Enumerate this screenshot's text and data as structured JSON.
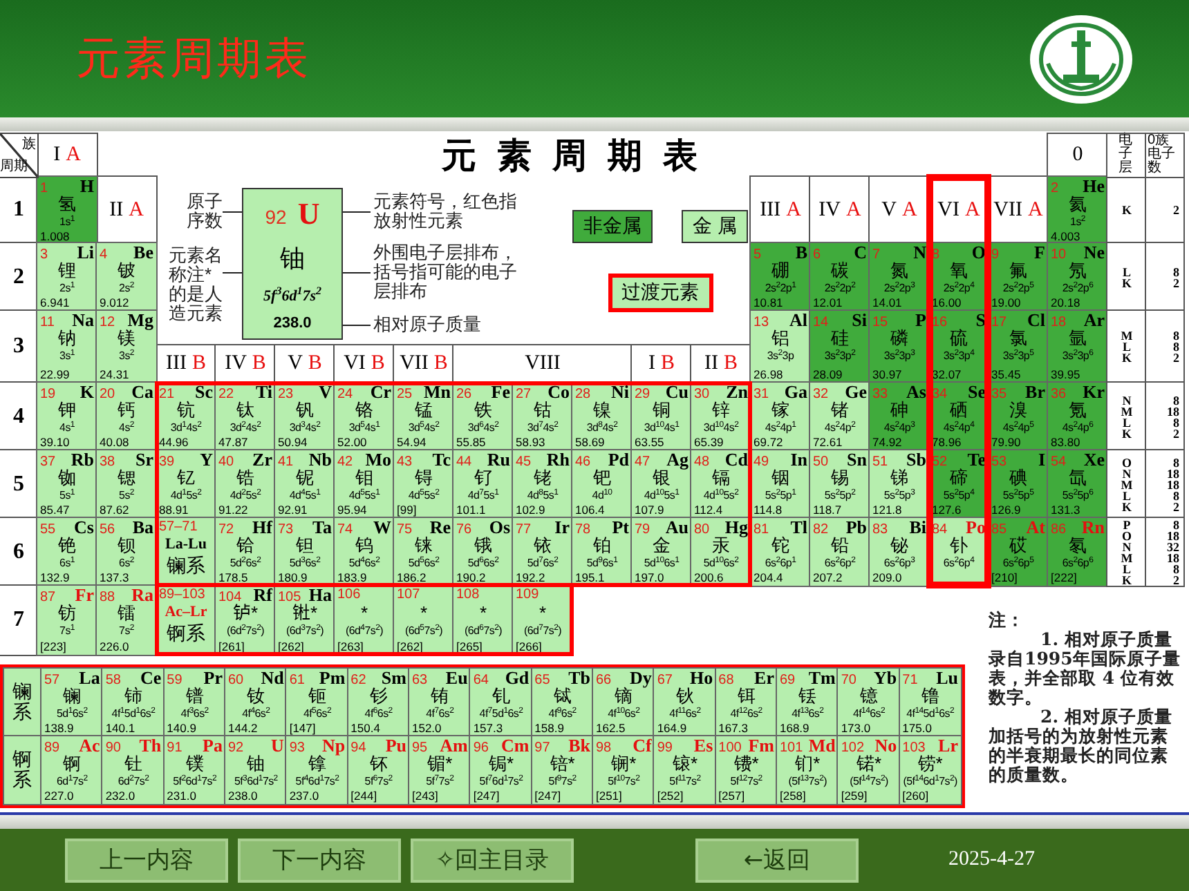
{
  "header": {
    "title": "元素周期表"
  },
  "table": {
    "corner": {
      "top": "族",
      "bottom": "周期"
    },
    "title": "元 素 周 期 表",
    "groups": [
      {
        "roman": "I",
        "letter": "A",
        "highlighted": false
      },
      {
        "roman": "II",
        "letter": "A",
        "highlighted": false
      },
      {
        "roman": "III",
        "letter": "B",
        "highlighted": false
      },
      {
        "roman": "IV",
        "letter": "B",
        "highlighted": false
      },
      {
        "roman": "V",
        "letter": "B",
        "highlighted": false
      },
      {
        "roman": "VI",
        "letter": "B",
        "highlighted": false
      },
      {
        "roman": "VII",
        "letter": "B",
        "highlighted": false
      },
      {
        "roman": "VIII",
        "highlighted": false
      },
      {
        "roman": "I",
        "letter": "B",
        "highlighted": false
      },
      {
        "roman": "II",
        "letter": "B",
        "highlighted": false
      },
      {
        "roman": "III",
        "letter": "A",
        "highlighted": false
      },
      {
        "roman": "IV",
        "letter": "A",
        "highlighted": false
      },
      {
        "roman": "V",
        "letter": "A",
        "highlighted": false
      },
      {
        "roman": "VI",
        "letter": "A",
        "highlighted": true
      },
      {
        "roman": "VII",
        "letter": "A",
        "highlighted": false
      },
      {
        "roman": "0",
        "highlighted": false
      }
    ],
    "shell_headers": [
      "电子层",
      "0族电子数"
    ],
    "periods": [
      {
        "number": "1",
        "shells": [
          "K"
        ],
        "counts": [
          "2"
        ],
        "cells": [
          {
            "n": "1",
            "symbol": "H",
            "name": "氢",
            "config": "1s$^{1}$",
            "mass": "1.008",
            "kind": "nonmetal",
            "radioactive": false
          },
          {
            "n": "2",
            "symbol": "He",
            "name": "氦",
            "config": "1s$^{2}$",
            "mass": "4.003",
            "kind": "nonmetal",
            "radioactive": false
          }
        ]
      },
      {
        "number": "2",
        "shells": [
          "L",
          "K"
        ],
        "counts": [
          "8",
          "2"
        ],
        "cells": [
          {
            "n": "3",
            "symbol": "Li",
            "name": "锂",
            "config": "2s$^{1}$",
            "mass": "6.941",
            "kind": "metal",
            "radioactive": false
          },
          {
            "n": "4",
            "symbol": "Be",
            "name": "铍",
            "config": "2s$^{2}$",
            "mass": "9.012",
            "kind": "metal",
            "radioactive": false
          },
          {
            "n": "5",
            "symbol": "B",
            "name": "硼",
            "config": "2s$^{2}$2p$^{1}$",
            "mass": "10.81",
            "kind": "nonmetal",
            "radioactive": false
          },
          {
            "n": "6",
            "symbol": "C",
            "name": "碳",
            "config": "2s$^{2}$2p$^{2}$",
            "mass": "12.01",
            "kind": "nonmetal",
            "radioactive": false
          },
          {
            "n": "7",
            "symbol": "N",
            "name": "氮",
            "config": "2s$^{2}$2p$^{3}$",
            "mass": "14.01",
            "kind": "nonmetal",
            "radioactive": false
          },
          {
            "n": "8",
            "symbol": "O",
            "name": "氧",
            "config": "2s$^{2}$2p$^{4}$",
            "mass": "16.00",
            "kind": "nonmetal",
            "radioactive": false
          },
          {
            "n": "9",
            "symbol": "F",
            "name": "氟",
            "config": "2s$^{2}$2p$^{5}$",
            "mass": "19.00",
            "kind": "nonmetal",
            "radioactive": false
          },
          {
            "n": "10",
            "symbol": "Ne",
            "name": "氖",
            "config": "2s$^{2}$2p$^{6}$",
            "mass": "20.18",
            "kind": "nonmetal",
            "radioactive": false
          }
        ]
      },
      {
        "number": "3",
        "shells": [
          "M",
          "L",
          "K"
        ],
        "counts": [
          "8",
          "8",
          "2"
        ],
        "cells": [
          {
            "n": "11",
            "symbol": "Na",
            "name": "钠",
            "config": "3s$^{1}$",
            "mass": "22.99",
            "kind": "metal",
            "radioactive": false
          },
          {
            "n": "12",
            "symbol": "Mg",
            "name": "镁",
            "config": "3s$^{2}$",
            "mass": "24.31",
            "kind": "metal",
            "radioactive": false
          },
          {
            "n": "13",
            "symbol": "Al",
            "name": "铝",
            "config": "3s$^{2}$3p",
            "mass": "26.98",
            "kind": "metal",
            "radioactive": false
          },
          {
            "n": "14",
            "symbol": "Si",
            "name": "硅",
            "config": "3s$^{2}$3p$^{2}$",
            "mass": "28.09",
            "kind": "nonmetal",
            "radioactive": false
          },
          {
            "n": "15",
            "symbol": "P",
            "name": "磷",
            "config": "3s$^{2}$3p$^{3}$",
            "mass": "30.97",
            "kind": "nonmetal",
            "radioactive": false
          },
          {
            "n": "16",
            "symbol": "S",
            "name": "硫",
            "config": "3s$^{2}$3p$^{4}$",
            "mass": "32.07",
            "kind": "nonmetal",
            "radioactive": false
          },
          {
            "n": "17",
            "symbol": "Cl",
            "name": "氯",
            "config": "3s$^{2}$3p$^{5}$",
            "mass": "35.45",
            "kind": "nonmetal",
            "radioactive": false
          },
          {
            "n": "18",
            "symbol": "Ar",
            "name": "氩",
            "config": "3s$^{2}$3p$^{6}$",
            "mass": "39.95",
            "kind": "nonmetal",
            "radioactive": false
          }
        ]
      },
      {
        "number": "4",
        "shells": [
          "N",
          "M",
          "L",
          "K"
        ],
        "counts": [
          "8",
          "18",
          "8",
          "2"
        ],
        "cells": [
          {
            "n": "19",
            "symbol": "K",
            "name": "钾",
            "config": "4s$^{1}$",
            "mass": "39.10",
            "kind": "metal",
            "radioactive": false
          },
          {
            "n": "20",
            "symbol": "Ca",
            "name": "钙",
            "config": "4s$^{2}$",
            "mass": "40.08",
            "kind": "metal",
            "radioactive": false
          },
          {
            "n": "21",
            "symbol": "Sc",
            "name": "钪",
            "config": "3d$^{1}$4s$^{2}$",
            "mass": "44.96",
            "kind": "metal",
            "radioactive": false
          },
          {
            "n": "22",
            "symbol": "Ti",
            "name": "钛",
            "config": "3d$^{2}$4s$^{2}$",
            "mass": "47.87",
            "kind": "metal",
            "radioactive": false
          },
          {
            "n": "23",
            "symbol": "V",
            "name": "钒",
            "config": "3d$^{3}$4s$^{2}$",
            "mass": "50.94",
            "kind": "metal",
            "radioactive": false
          },
          {
            "n": "24",
            "symbol": "Cr",
            "name": "铬",
            "config": "3d$^{5}$4s$^{1}$",
            "mass": "52.00",
            "kind": "metal",
            "radioactive": false
          },
          {
            "n": "25",
            "symbol": "Mn",
            "name": "锰",
            "config": "3d$^{5}$4s$^{2}$",
            "mass": "54.94",
            "kind": "metal",
            "radioactive": false
          },
          {
            "n": "26",
            "symbol": "Fe",
            "name": "铁",
            "config": "3d$^{6}$4s$^{2}$",
            "mass": "55.85",
            "kind": "metal",
            "radioactive": false
          },
          {
            "n": "27",
            "symbol": "Co",
            "name": "钴",
            "config": "3d$^{7}$4s$^{2}$",
            "mass": "58.93",
            "kind": "metal",
            "radioactive": false
          },
          {
            "n": "28",
            "symbol": "Ni",
            "name": "镍",
            "config": "3d$^{8}$4s$^{2}$",
            "mass": "58.69",
            "kind": "metal",
            "radioactive": false
          },
          {
            "n": "29",
            "symbol": "Cu",
            "name": "铜",
            "config": "3d$^{10}$4s$^{1}$",
            "mass": "63.55",
            "kind": "metal",
            "radioactive": false
          },
          {
            "n": "30",
            "symbol": "Zn",
            "name": "锌",
            "config": "3d$^{10}$4s$^{2}$",
            "mass": "65.39",
            "kind": "metal",
            "radioactive": false
          },
          {
            "n": "31",
            "symbol": "Ga",
            "name": "镓",
            "config": "4s$^{2}$4p$^{1}$",
            "mass": "69.72",
            "kind": "metal",
            "radioactive": false
          },
          {
            "n": "32",
            "symbol": "Ge",
            "name": "锗",
            "config": "4s$^{2}$4p$^{2}$",
            "mass": "72.61",
            "kind": "metal",
            "radioactive": false
          },
          {
            "n": "33",
            "symbol": "As",
            "name": "砷",
            "config": "4s$^{2}$4p$^{3}$",
            "mass": "74.92",
            "kind": "nonmetal",
            "radioactive": false
          },
          {
            "n": "34",
            "symbol": "Se",
            "name": "硒",
            "config": "4s$^{2}$4p$^{4}$",
            "mass": "78.96",
            "kind": "nonmetal",
            "radioactive": false
          },
          {
            "n": "35",
            "symbol": "Br",
            "name": "溴",
            "config": "4s$^{2}$4p$^{5}$",
            "mass": "79.90",
            "kind": "nonmetal",
            "radioactive": false
          },
          {
            "n": "36",
            "symbol": "Kr",
            "name": "氪",
            "config": "4s$^{2}$4p$^{6}$",
            "mass": "83.80",
            "kind": "nonmetal",
            "radioactive": false
          }
        ]
      },
      {
        "number": "5",
        "shells": [
          "O",
          "N",
          "M",
          "L",
          "K"
        ],
        "counts": [
          "8",
          "18",
          "18",
          "8",
          "2"
        ],
        "cells": [
          {
            "n": "37",
            "symbol": "Rb",
            "name": "铷",
            "config": "5s$^{1}$",
            "mass": "85.47",
            "kind": "metal",
            "radioactive": false
          },
          {
            "n": "38",
            "symbol": "Sr",
            "name": "锶",
            "config": "5s$^{2}$",
            "mass": "87.62",
            "kind": "metal",
            "radioactive": false
          },
          {
            "n": "39",
            "symbol": "Y",
            "name": "钇",
            "config": "4d$^{1}$5s$^{2}$",
            "mass": "88.91",
            "kind": "metal",
            "radioactive": false
          },
          {
            "n": "40",
            "symbol": "Zr",
            "name": "锆",
            "config": "4d$^{2}$5s$^{2}$",
            "mass": "91.22",
            "kind": "metal",
            "radioactive": false
          },
          {
            "n": "41",
            "symbol": "Nb",
            "name": "铌",
            "config": "4d$^{4}$5s$^{1}$",
            "mass": "92.91",
            "kind": "metal",
            "radioactive": false
          },
          {
            "n": "42",
            "symbol": "Mo",
            "name": "钼",
            "config": "4d$^{5}$5s$^{1}$",
            "mass": "95.94",
            "kind": "metal",
            "radioactive": false
          },
          {
            "n": "43",
            "symbol": "Tc",
            "name": "锝",
            "config": "4d$^{5}$5s$^{2}$",
            "mass": "[99]",
            "kind": "metal",
            "radioactive": false
          },
          {
            "n": "44",
            "symbol": "Ru",
            "name": "钌",
            "config": "4d$^{7}$5s$^{1}$",
            "mass": "101.1",
            "kind": "metal",
            "radioactive": false
          },
          {
            "n": "45",
            "symbol": "Rh",
            "name": "铑",
            "config": "4d$^{8}$5s$^{1}$",
            "mass": "102.9",
            "kind": "metal",
            "radioactive": false
          },
          {
            "n": "46",
            "symbol": "Pd",
            "name": "钯",
            "config": "4d$^{10}$",
            "mass": "106.4",
            "kind": "metal",
            "radioactive": false
          },
          {
            "n": "47",
            "symbol": "Ag",
            "name": "银",
            "config": "4d$^{10}$5s$^{1}$",
            "mass": "107.9",
            "kind": "metal",
            "radioactive": false
          },
          {
            "n": "48",
            "symbol": "Cd",
            "name": "镉",
            "config": "4d$^{10}$5s$^{2}$",
            "mass": "112.4",
            "kind": "metal",
            "radioactive": false
          },
          {
            "n": "49",
            "symbol": "In",
            "name": "铟",
            "config": "5s$^{2}$5p$^{1}$",
            "mass": "114.8",
            "kind": "metal",
            "radioactive": false
          },
          {
            "n": "50",
            "symbol": "Sn",
            "name": "锡",
            "config": "5s$^{2}$5p$^{2}$",
            "mass": "118.7",
            "kind": "metal",
            "radioactive": false
          },
          {
            "n": "51",
            "symbol": "Sb",
            "name": "锑",
            "config": "5s$^{2}$5p$^{3}$",
            "mass": "121.8",
            "kind": "metal",
            "radioactive": false
          },
          {
            "n": "52",
            "symbol": "Te",
            "name": "碲",
            "config": "5s$^{2}$5p$^{4}$",
            "mass": "127.6",
            "kind": "nonmetal",
            "radioactive": false
          },
          {
            "n": "53",
            "symbol": "I",
            "name": "碘",
            "config": "5s$^{2}$5p$^{5}$",
            "mass": "126.9",
            "kind": "nonmetal",
            "radioactive": false
          },
          {
            "n": "54",
            "symbol": "Xe",
            "name": "氙",
            "config": "5s$^{2}$5p$^{6}$",
            "mass": "131.3",
            "kind": "nonmetal",
            "radioactive": false
          }
        ]
      },
      {
        "number": "6",
        "shells": [
          "P",
          "O",
          "N",
          "M",
          "L",
          "K"
        ],
        "counts": [
          "8",
          "18",
          "32",
          "18",
          "8",
          "2"
        ],
        "cells": [
          {
            "n": "55",
            "symbol": "Cs",
            "name": "铯",
            "config": "6s$^{1}$",
            "mass": "132.9",
            "kind": "metal",
            "radioactive": false
          },
          {
            "n": "56",
            "symbol": "Ba",
            "name": "钡",
            "config": "6s$^{2}$",
            "mass": "137.3",
            "kind": "metal",
            "radioactive": false
          },
          {
            "n": "57–71",
            "symbol": "La-Lu",
            "name": "镧系",
            "kind": "series",
            "radioactive": false
          },
          {
            "n": "72",
            "symbol": "Hf",
            "name": "铪",
            "config": "5d$^{2}$6s$^{2}$",
            "mass": "178.5",
            "kind": "metal",
            "radioactive": false
          },
          {
            "n": "73",
            "symbol": "Ta",
            "name": "钽",
            "config": "5d$^{3}$6s$^{2}$",
            "mass": "180.9",
            "kind": "metal",
            "radioactive": false
          },
          {
            "n": "74",
            "symbol": "W",
            "name": "钨",
            "config": "5d$^{4}$6s$^{2}$",
            "mass": "183.9",
            "kind": "metal",
            "radioactive": false
          },
          {
            "n": "75",
            "symbol": "Re",
            "name": "铼",
            "config": "5d$^{5}$6s$^{2}$",
            "mass": "186.2",
            "kind": "metal",
            "radioactive": false
          },
          {
            "n": "76",
            "symbol": "Os",
            "name": "锇",
            "config": "5d$^{6}$6s$^{2}$",
            "mass": "190.2",
            "kind": "metal",
            "radioactive": false
          },
          {
            "n": "77",
            "symbol": "Ir",
            "name": "铱",
            "config": "5d$^{7}$6s$^{2}$",
            "mass": "192.2",
            "kind": "metal",
            "radioactive": false
          },
          {
            "n": "78",
            "symbol": "Pt",
            "name": "铂",
            "config": "5d$^{9}$6s$^{1}$",
            "mass": "195.1",
            "kind": "metal",
            "radioactive": false
          },
          {
            "n": "79",
            "symbol": "Au",
            "name": "金",
            "config": "5d$^{10}$6s$^{1}$",
            "mass": "197.0",
            "kind": "metal",
            "radioactive": false
          },
          {
            "n": "80",
            "symbol": "Hg",
            "name": "汞",
            "config": "5d$^{10}$6s$^{2}$",
            "mass": "200.6",
            "kind": "metal",
            "radioactive": false
          },
          {
            "n": "81",
            "symbol": "Tl",
            "name": "铊",
            "config": "6s$^{2}$6p$^{1}$",
            "mass": "204.4",
            "kind": "metal",
            "radioactive": false
          },
          {
            "n": "82",
            "symbol": "Pb",
            "name": "铅",
            "config": "6s$^{2}$6p$^{2}$",
            "mass": "207.2",
            "kind": "metal",
            "radioactive": false
          },
          {
            "n": "83",
            "symbol": "Bi",
            "name": "铋",
            "config": "6s$^{2}$6p$^{3}$",
            "mass": "209.0",
            "kind": "metal",
            "radioactive": false
          },
          {
            "n": "84",
            "symbol": "Po",
            "name": "钋",
            "config": "6s$^{2}$6p$^{4}$",
            "kind": "metal",
            "radioactive": true
          },
          {
            "n": "85",
            "symbol": "At",
            "name": "砹",
            "config": "6s$^{2}$6p$^{5}$",
            "mass": "[210]",
            "kind": "nonmetal",
            "radioactive": true
          },
          {
            "n": "86",
            "symbol": "Rn",
            "name": "氡",
            "config": "6s$^{2}$6p$^{6}$",
            "mass": "[222]",
            "kind": "nonmetal",
            "radioactive": true
          }
        ]
      },
      {
        "number": "7",
        "cells": [
          {
            "n": "87",
            "symbol": "Fr",
            "name": "钫",
            "config": "7s$^{1}$",
            "mass": "[223]",
            "kind": "metal",
            "radioactive": true
          },
          {
            "n": "88",
            "symbol": "Ra",
            "name": "镭",
            "config": "7s$^{2}$",
            "mass": "226.0",
            "kind": "metal",
            "radioactive": true
          },
          {
            "n": "89–103",
            "symbol": "Ac–Lr",
            "name": "锕系",
            "kind": "series",
            "radioactive": true
          },
          {
            "n": "104",
            "symbol": "Rf",
            "name": "𬬻*",
            "config": "(6d$^{2}$7s$^{2}$)",
            "mass": "[261]",
            "kind": "metal",
            "radioactive": false
          },
          {
            "n": "105",
            "symbol": "Ha",
            "name": "𬭊*",
            "config": "(6d$^{3}$7s$^{2}$)",
            "mass": "[262]",
            "kind": "metal",
            "radioactive": false
          },
          {
            "n": "106",
            "name": "*",
            "config": "(6d$^{4}$7s$^{2}$)",
            "mass": "[263]",
            "kind": "metal"
          },
          {
            "n": "107",
            "name": "*",
            "config": "(6d$^{5}$7s$^{2}$)",
            "mass": "[262]",
            "kind": "metal"
          },
          {
            "n": "108",
            "name": "*",
            "config": "(6d$^{6}$7s$^{2}$)",
            "mass": "[265]",
            "kind": "metal"
          },
          {
            "n": "109",
            "name": "*",
            "config": "(6d$^{7}$7s$^{2}$)",
            "mass": "[266]",
            "kind": "metal"
          }
        ]
      }
    ],
    "legend": {
      "sample": {
        "number": "92",
        "symbol": "U",
        "name": "铀",
        "config": "5f$^{3}$6d$^{1}$7s$^{2}$",
        "mass": "238.0"
      },
      "left_labels": [
        "原子序数",
        "元素名称注*的是人造元素"
      ],
      "right_labels": [
        "元素符号，红色指放射性元素",
        "外围电子层排布，括号指可能的电子层排布",
        "相对原子质量"
      ]
    },
    "categories": [
      {
        "label": "非金属",
        "kind": "nonmetal"
      },
      {
        "label": "金 属",
        "kind": "metal"
      },
      {
        "label": "过渡元素",
        "kind": "transition"
      }
    ]
  },
  "series": [
    {
      "label": "镧系",
      "cells": [
        {
          "n": "57",
          "symbol": "La",
          "name": "镧",
          "config": "5d$^{1}$6s$^{2}$",
          "mass": "138.9",
          "kind": "metal",
          "radioactive": false
        },
        {
          "n": "58",
          "symbol": "Ce",
          "name": "铈",
          "config": "4f$^{1}$5d$^{1}$6s$^{2}$",
          "mass": "140.1",
          "kind": "metal",
          "radioactive": false
        },
        {
          "n": "59",
          "symbol": "Pr",
          "name": "镨",
          "config": "4f$^{3}$6s$^{2}$",
          "mass": "140.9",
          "kind": "metal",
          "radioactive": false
        },
        {
          "n": "60",
          "symbol": "Nd",
          "name": "钕",
          "config": "4f$^{4}$6s$^{2}$",
          "mass": "144.2",
          "kind": "metal",
          "radioactive": false
        },
        {
          "n": "61",
          "symbol": "Pm",
          "name": "钷",
          "config": "4f$^{5}$6s$^{2}$",
          "mass": "[147]",
          "kind": "metal",
          "radioactive": false
        },
        {
          "n": "62",
          "symbol": "Sm",
          "name": "钐",
          "config": "4f$^{6}$6s$^{2}$",
          "mass": "150.4",
          "kind": "metal",
          "radioactive": false
        },
        {
          "n": "63",
          "symbol": "Eu",
          "name": "铕",
          "config": "4f$^{7}$6s$^{2}$",
          "mass": "152.0",
          "kind": "metal",
          "radioactive": false
        },
        {
          "n": "64",
          "symbol": "Gd",
          "name": "钆",
          "config": "4f$^{7}$5d$^{1}$6s$^{2}$",
          "mass": "157.3",
          "kind": "metal",
          "radioactive": false
        },
        {
          "n": "65",
          "symbol": "Tb",
          "name": "铽",
          "config": "4f$^{9}$6s$^{2}$",
          "mass": "158.9",
          "kind": "metal",
          "radioactive": false
        },
        {
          "n": "66",
          "symbol": "Dy",
          "name": "镝",
          "config": "4f$^{10}$6s$^{2}$",
          "mass": "162.5",
          "kind": "metal",
          "radioactive": false
        },
        {
          "n": "67",
          "symbol": "Ho",
          "name": "钬",
          "config": "4f$^{11}$6s$^{2}$",
          "mass": "164.9",
          "kind": "metal",
          "radioactive": false
        },
        {
          "n": "68",
          "symbol": "Er",
          "name": "铒",
          "config": "4f$^{12}$6s$^{2}$",
          "mass": "167.3",
          "kind": "metal",
          "radioactive": false
        },
        {
          "n": "69",
          "symbol": "Tm",
          "name": "铥",
          "config": "4f$^{13}$6s$^{2}$",
          "mass": "168.9",
          "kind": "metal",
          "radioactive": false
        },
        {
          "n": "70",
          "symbol": "Yb",
          "name": "镱",
          "config": "4f$^{14}$6s$^{2}$",
          "mass": "173.0",
          "kind": "metal",
          "radioactive": false
        },
        {
          "n": "71",
          "symbol": "Lu",
          "name": "镥",
          "config": "4f$^{14}$5d$^{1}$6s$^{2}$",
          "mass": "175.0",
          "kind": "metal",
          "radioactive": false
        }
      ]
    },
    {
      "label": "锕系",
      "cells": [
        {
          "n": "89",
          "symbol": "Ac",
          "name": "锕",
          "config": "6d$^{1}$7s$^{2}$",
          "mass": "227.0",
          "kind": "metal",
          "radioactive": true
        },
        {
          "n": "90",
          "symbol": "Th",
          "name": "钍",
          "config": "6d$^{2}$7s$^{2}$",
          "mass": "232.0",
          "kind": "metal",
          "radioactive": true
        },
        {
          "n": "91",
          "symbol": "Pa",
          "name": "镤",
          "config": "5f$^{2}$6d$^{1}$7s$^{2}$",
          "mass": "231.0",
          "kind": "metal",
          "radioactive": true
        },
        {
          "n": "92",
          "symbol": "U",
          "name": "铀",
          "config": "5f$^{3}$6d$^{1}$7s$^{2}$",
          "mass": "238.0",
          "kind": "metal",
          "radioactive": true
        },
        {
          "n": "93",
          "symbol": "Np",
          "name": "镎",
          "config": "5f$^{4}$6d$^{1}$7s$^{2}$",
          "mass": "237.0",
          "kind": "metal",
          "radioactive": true
        },
        {
          "n": "94",
          "symbol": "Pu",
          "name": "钚",
          "config": "5f$^{6}$7s$^{2}$",
          "mass": "[244]",
          "kind": "metal",
          "radioactive": true
        },
        {
          "n": "95",
          "symbol": "Am",
          "name": "镅*",
          "config": "5f$^{7}$7s$^{2}$",
          "mass": "[243]",
          "kind": "metal",
          "radioactive": true
        },
        {
          "n": "96",
          "symbol": "Cm",
          "name": "锔*",
          "config": "5f$^{7}$6d$^{1}$7s$^{2}$",
          "mass": "[247]",
          "kind": "metal",
          "radioactive": true
        },
        {
          "n": "97",
          "symbol": "Bk",
          "name": "锫*",
          "config": "5f$^{9}$7s$^{2}$",
          "mass": "[247]",
          "kind": "metal",
          "radioactive": true
        },
        {
          "n": "98",
          "symbol": "Cf",
          "name": "锎*",
          "config": "5f$^{10}$7s$^{2}$",
          "mass": "[251]",
          "kind": "metal",
          "radioactive": true
        },
        {
          "n": "99",
          "symbol": "Es",
          "name": "锿*",
          "config": "5f$^{11}$7s$^{2}$",
          "mass": "[252]",
          "kind": "metal",
          "radioactive": true
        },
        {
          "n": "100",
          "symbol": "Fm",
          "name": "镄*",
          "config": "5f$^{12}$7s$^{2}$",
          "mass": "[257]",
          "kind": "metal",
          "radioactive": true
        },
        {
          "n": "101",
          "symbol": "Md",
          "name": "钔*",
          "config": "(5f$^{13}$7s$^{2}$)",
          "mass": "[258]",
          "kind": "metal",
          "radioactive": true
        },
        {
          "n": "102",
          "symbol": "No",
          "name": "锘*",
          "config": "(5f$^{14}$7s$^{2}$)",
          "mass": "[259]",
          "kind": "metal",
          "radioactive": true
        },
        {
          "n": "103",
          "symbol": "Lr",
          "name": "铹*",
          "config": "(5f$^{14}$6d$^{1}$7s$^{2}$)",
          "mass": "[260]",
          "kind": "metal",
          "radioactive": true
        }
      ]
    }
  ],
  "notes": {
    "heading": "注：",
    "items": [
      "1. 相对原子质量录自1995年国际原子量表，并全部取 4 位有效数字。",
      "2. 相对原子质量加括号的为放射性元素的半衰期最长的同位素的质量数。"
    ]
  },
  "footer": {
    "buttons": [
      "上一内容",
      "下一内容",
      "✧回主目录",
      "←返回"
    ],
    "date": "2025-4-27"
  }
}
